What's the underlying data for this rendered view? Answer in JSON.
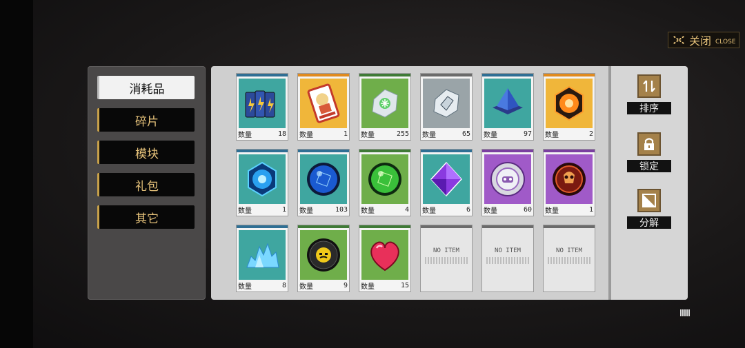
{
  "close": {
    "label": "关闭",
    "sub": "CLOSE"
  },
  "categories": [
    {
      "label": "消耗品",
      "active": true
    },
    {
      "label": "碎片",
      "active": false
    },
    {
      "label": "模块",
      "active": false
    },
    {
      "label": "礼包",
      "active": false
    },
    {
      "label": "其它",
      "active": false
    }
  ],
  "qty_label": "数量",
  "items": [
    {
      "icon": "battery-pack-icon",
      "bar": "#2f6f94",
      "bg": "#3fa6a0",
      "qty": "18"
    },
    {
      "icon": "character-card-icon",
      "bar": "#e08a1e",
      "bg": "#f0b63a",
      "qty": "1"
    },
    {
      "icon": "green-crystal-chip-icon",
      "bar": "#3f7a36",
      "bg": "#6fae4a",
      "qty": "255"
    },
    {
      "icon": "gray-crystal-chip-icon",
      "bar": "#6b6b6b",
      "bg": "#9aa4a8",
      "qty": "65"
    },
    {
      "icon": "blue-pyramid-icon",
      "bar": "#2f6f94",
      "bg": "#3fa6a0",
      "qty": "97"
    },
    {
      "icon": "orange-core-icon",
      "bar": "#e08a1e",
      "bg": "#f0b63a",
      "qty": "2"
    },
    {
      "icon": "blue-hex-core-icon",
      "bar": "#2f6f94",
      "bg": "#3fa6a0",
      "qty": "1"
    },
    {
      "icon": "blue-orb-icon",
      "bar": "#2f6f94",
      "bg": "#3fa6a0",
      "qty": "103"
    },
    {
      "icon": "green-orb-icon",
      "bar": "#3f7a36",
      "bg": "#6fae4a",
      "qty": "4"
    },
    {
      "icon": "purple-gem-icon",
      "bar": "#2f6f94",
      "bg": "#3fa6a0",
      "qty": "6"
    },
    {
      "icon": "purple-emblem-icon",
      "bar": "#7a3fa0",
      "bg": "#a05ac8",
      "qty": "60"
    },
    {
      "icon": "red-skull-orb-icon",
      "bar": "#7a3fa0",
      "bg": "#a05ac8",
      "qty": "1"
    },
    {
      "icon": "blue-crystal-pile-icon",
      "bar": "#2f6f94",
      "bg": "#3fa6a0",
      "qty": "8"
    },
    {
      "icon": "yellow-face-disc-icon",
      "bar": "#3f7a36",
      "bg": "#6fae4a",
      "qty": "9"
    },
    {
      "icon": "pink-heart-icon",
      "bar": "#3f7a36",
      "bg": "#6fae4a",
      "qty": "15"
    }
  ],
  "empty_slots": [
    {
      "text": "NO ITEM"
    },
    {
      "text": "NO ITEM"
    },
    {
      "text": "NO ITEM"
    }
  ],
  "actions": [
    {
      "label": "排序",
      "icon": "sort-icon"
    },
    {
      "label": "锁定",
      "icon": "lock-icon"
    },
    {
      "label": "分解",
      "icon": "disassemble-icon"
    }
  ]
}
